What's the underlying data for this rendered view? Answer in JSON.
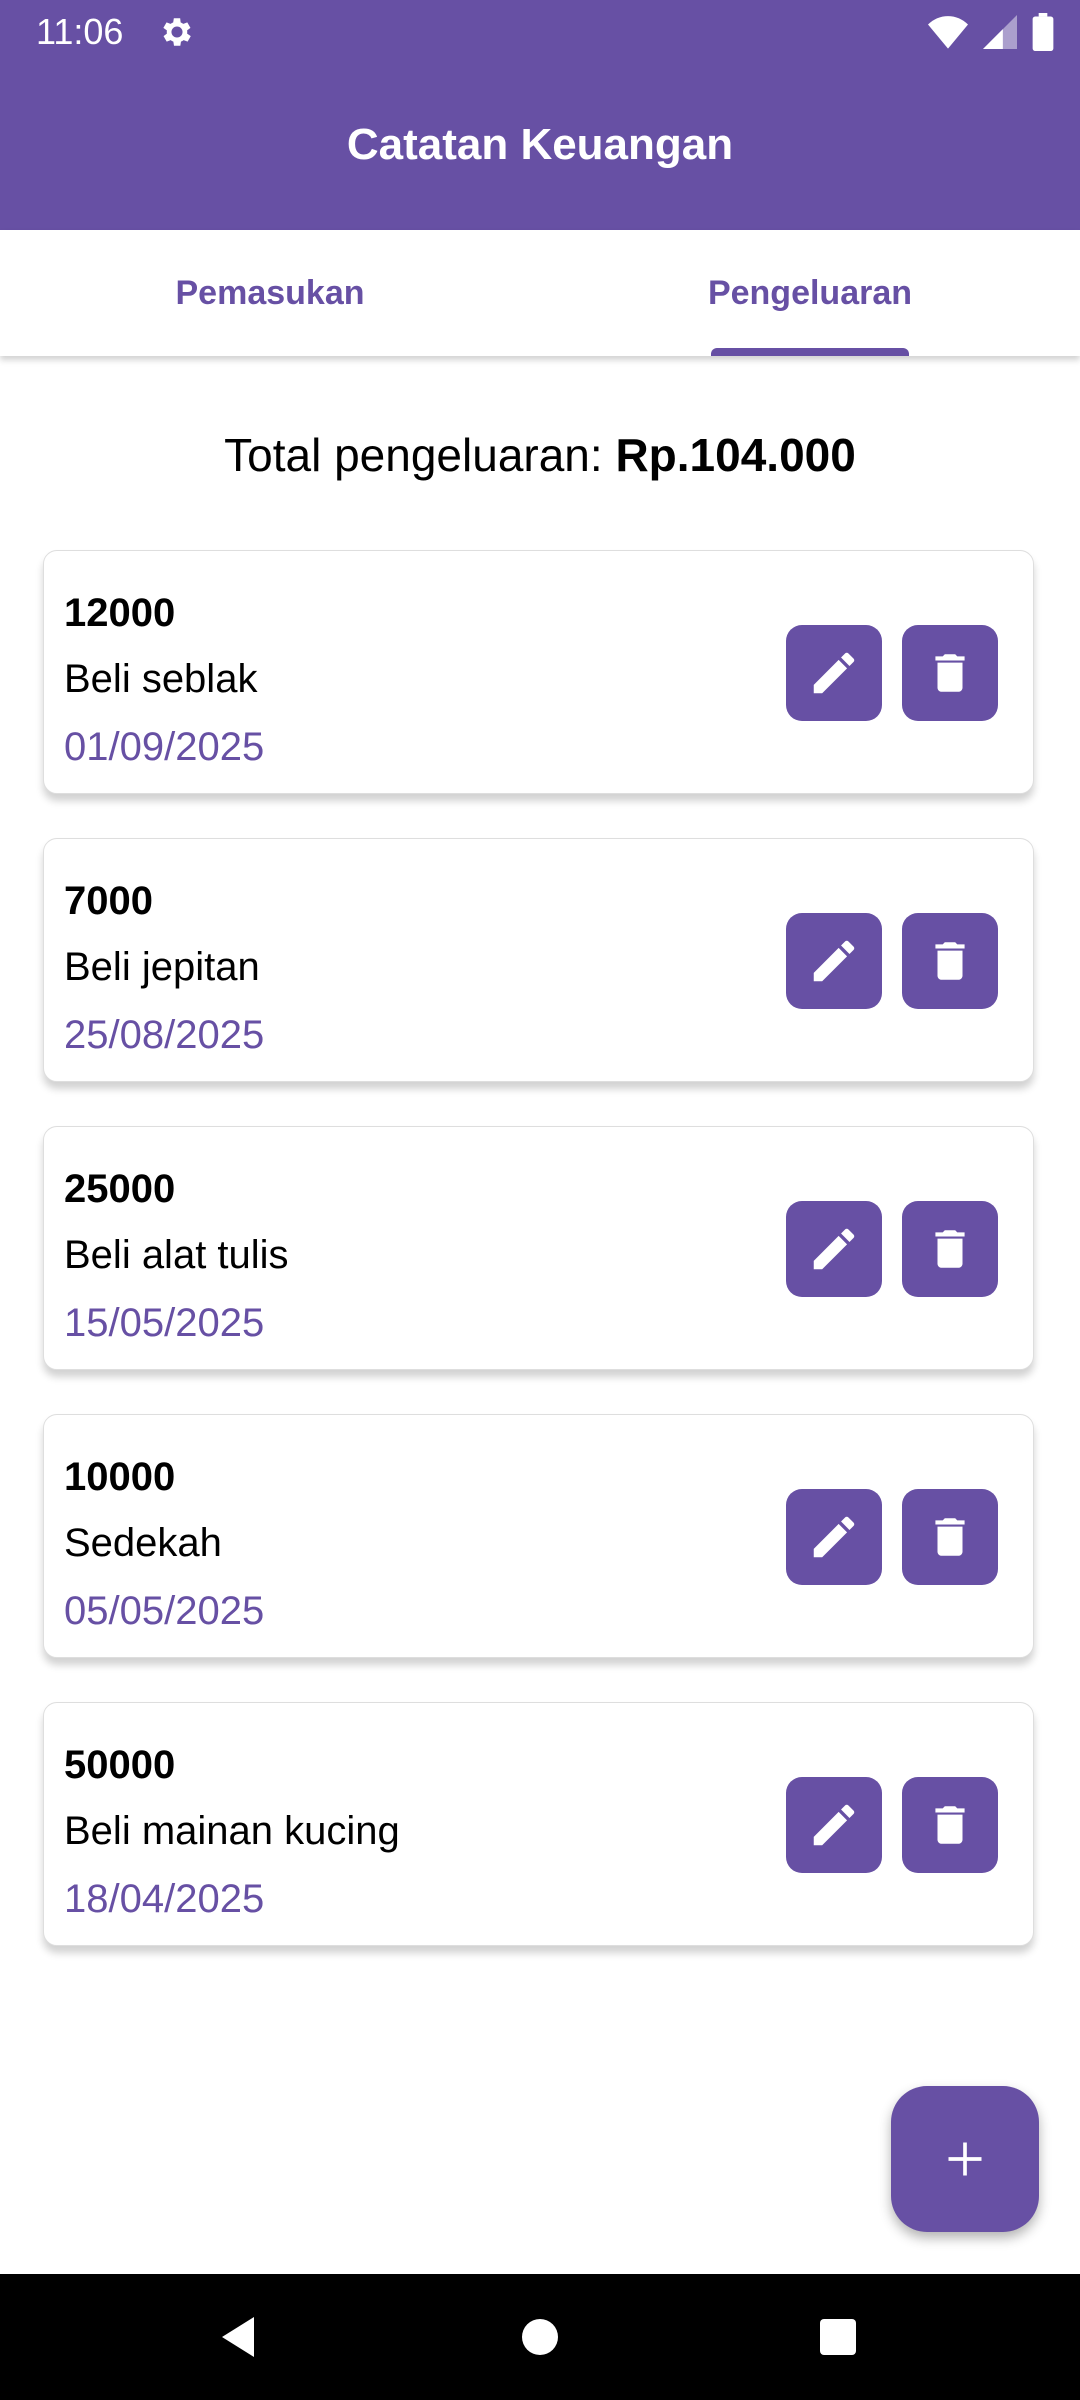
{
  "status_bar": {
    "time": "11:06"
  },
  "app": {
    "title": "Catatan Keuangan"
  },
  "tabs": [
    {
      "label": "Pemasukan",
      "selected": false
    },
    {
      "label": "Pengeluaran",
      "selected": true
    }
  ],
  "total": {
    "label": "Total pengeluaran:",
    "value": "Rp.104.000"
  },
  "transactions": [
    {
      "amount": "12000",
      "description": "Beli seblak",
      "date": "01/09/2025"
    },
    {
      "amount": "7000",
      "description": "Beli jepitan",
      "date": "25/08/2025"
    },
    {
      "amount": "25000",
      "description": "Beli alat tulis",
      "date": "15/05/2025"
    },
    {
      "amount": "10000",
      "description": "Sedekah",
      "date": "05/05/2025"
    },
    {
      "amount": "50000",
      "description": "Beli mainan kucing",
      "date": "18/04/2025"
    }
  ],
  "icons": {
    "status_left": "gear-icon",
    "status_right": [
      "wifi-icon",
      "signal-icon",
      "battery-icon"
    ],
    "card_actions": [
      "pencil-icon",
      "trash-icon"
    ],
    "fab": "plus-icon",
    "nav": [
      "back-icon",
      "home-icon",
      "recents-icon"
    ]
  },
  "colors": {
    "primary": "#6750A4",
    "surface": "#FFFFFF",
    "nav_bar": "#000000"
  }
}
